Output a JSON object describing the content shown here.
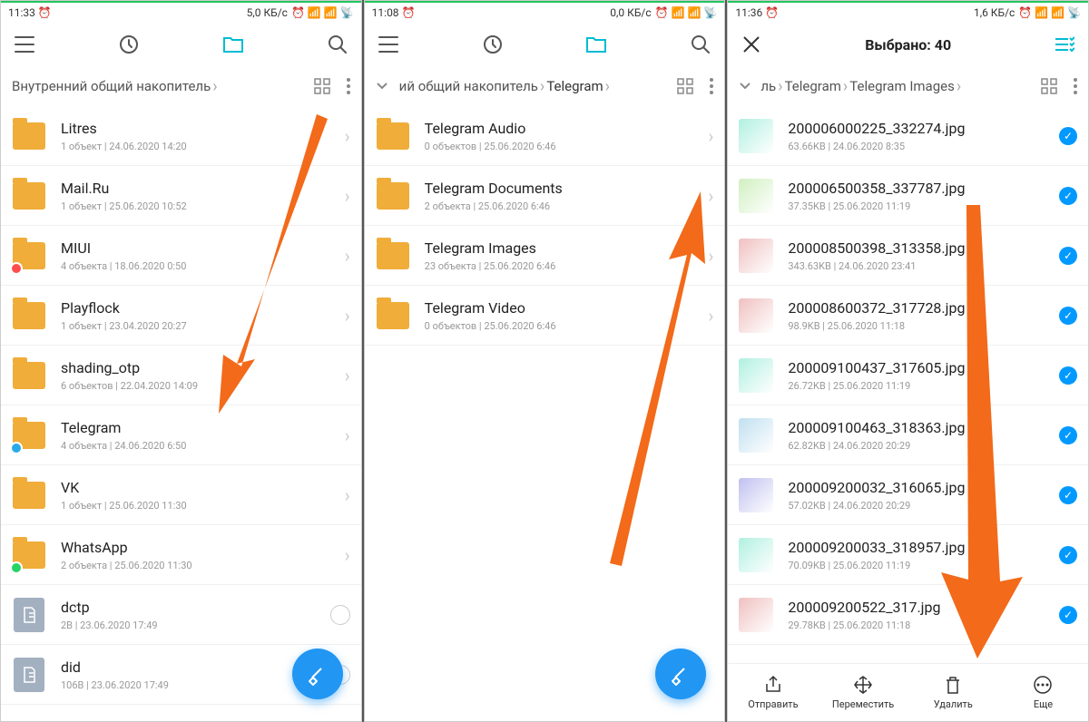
{
  "screens": [
    {
      "status": {
        "time": "11:33",
        "speed": "5,0 КБ/с"
      },
      "breadcrumb": "Внутренний общий накопитель",
      "items": [
        {
          "name": "Litres",
          "meta": "1 объект  |  24.06.2020 14:20",
          "type": "folder"
        },
        {
          "name": "Mail.Ru",
          "meta": "1 объект  |  25.06.2020 10:52",
          "type": "folder"
        },
        {
          "name": "MIUI",
          "meta": "4 объекта  |  18.06.2020 0:50",
          "type": "folder",
          "badge": "miui"
        },
        {
          "name": "Playflock",
          "meta": "1 объект  |  23.04.2020 20:27",
          "type": "folder"
        },
        {
          "name": "shading_otp",
          "meta": "6 объектов  |  22.04.2020 14:09",
          "type": "folder"
        },
        {
          "name": "Telegram",
          "meta": "4 объекта  |  24.06.2020 6:50",
          "type": "folder",
          "badge": "tg"
        },
        {
          "name": "VK",
          "meta": "1 объект  |  25.06.2020 11:30",
          "type": "folder"
        },
        {
          "name": "WhatsApp",
          "meta": "2 объекта  |  25.06.2020 11:30",
          "type": "folder",
          "badge": "wa"
        },
        {
          "name": "dctp",
          "meta": "2B  |  23.06.2020 17:49",
          "type": "file"
        },
        {
          "name": "did",
          "meta": "106B  |  23.06.2020 17:49",
          "type": "file"
        }
      ]
    },
    {
      "status": {
        "time": "11:08",
        "speed": "0,0 КБ/с"
      },
      "breadcrumb_parts": [
        "ий общий накопитель",
        "Telegram"
      ],
      "items": [
        {
          "name": "Telegram Audio",
          "meta": "0 объектов  |  25.06.2020 6:46",
          "type": "folder"
        },
        {
          "name": "Telegram Documents",
          "meta": "2 объекта  |  25.06.2020 6:46",
          "type": "folder"
        },
        {
          "name": "Telegram Images",
          "meta": "23 объекта  |  25.06.2020 6:46",
          "type": "folder"
        },
        {
          "name": "Telegram Video",
          "meta": "0 объектов  |  25.06.2020 6:46",
          "type": "folder"
        }
      ]
    },
    {
      "status": {
        "time": "11:36",
        "speed": "1,6 КБ/с"
      },
      "selection_title": "Выбрано: 40",
      "breadcrumb_parts": [
        "ль",
        "Telegram",
        "Telegram Images"
      ],
      "items": [
        {
          "name": "200006000225_332274.jpg",
          "meta": "63.66KB  |  24.06.2020 8:35",
          "type": "img"
        },
        {
          "name": "200006500358_337787.jpg",
          "meta": "37.35KB  |  25.06.2020 11:19",
          "type": "img"
        },
        {
          "name": "200008500398_313358.jpg",
          "meta": "343.63KB  |  24.06.2020 23:41",
          "type": "img"
        },
        {
          "name": "200008600372_317728.jpg",
          "meta": "98.9KB  |  25.06.2020 11:18",
          "type": "img"
        },
        {
          "name": "200009100437_317605.jpg",
          "meta": "26.72KB  |  25.06.2020 11:19",
          "type": "img"
        },
        {
          "name": "200009100463_318363.jpg",
          "meta": "62.82KB  |  24.06.2020 20:29",
          "type": "img"
        },
        {
          "name": "200009200032_316065.jpg",
          "meta": "57.02KB  |  24.06.2020 20:29",
          "type": "img"
        },
        {
          "name": "200009200033_318957.jpg",
          "meta": "70.09KB  |  25.06.2020 11:19",
          "type": "img"
        },
        {
          "name": "200009200522_317.jpg",
          "meta": "29.78KB  |  25.06.2020 11:18",
          "type": "img"
        }
      ],
      "bottom": {
        "send": "Отправить",
        "move": "Переместить",
        "delete": "Удалить",
        "more": "Еще"
      }
    }
  ]
}
